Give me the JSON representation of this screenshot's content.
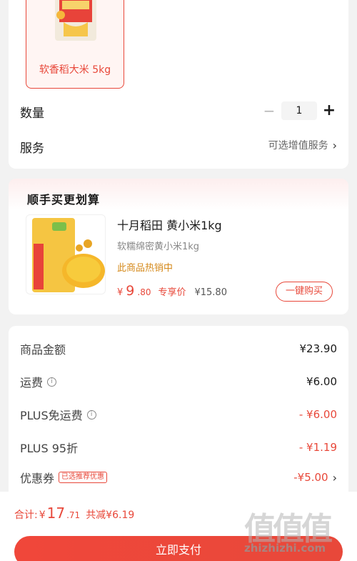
{
  "product": {
    "variant_label": "软香稻大米 5kg",
    "quantity_label": "数量",
    "quantity_value": "1",
    "minus_symbol": "−",
    "plus_symbol": "+",
    "service_label": "服务",
    "service_value": "可选增值服务",
    "chevron": "›"
  },
  "bundle": {
    "title": "顺手买更划算",
    "name": "十月稻田 黄小米1kg",
    "desc": "软糯绵密黄小米1kg",
    "hot": "此商品热销中",
    "currency": "¥",
    "price_int": "9",
    "price_dec": ".80",
    "price_tag": "专享价",
    "price_orig": "¥15.80",
    "buy_label": "一键购买"
  },
  "summary": {
    "rows": [
      {
        "label": "商品金额",
        "value": "¥23.90"
      },
      {
        "label": "运费",
        "value": "¥6.00"
      },
      {
        "label": "PLUS免运费",
        "value": "- ¥6.00"
      },
      {
        "label": "PLUS 95折",
        "value": "- ¥1.19"
      },
      {
        "label": "优惠券",
        "tag": "已选推荐优惠",
        "value": "-¥5.00"
      }
    ],
    "info_symbol": "i"
  },
  "bottom": {
    "total_label": "合计:",
    "currency": "¥",
    "total_int": "17",
    "total_dec": ".71",
    "save_text": "共减¥6.19",
    "pay_label": "立即支付"
  },
  "watermark": {
    "logo": "值值值",
    "text": "zhizhizhi.com"
  },
  "colors": {
    "accent": "#e8483a",
    "hot": "#d58a1c",
    "background": "#f2f2f2"
  }
}
